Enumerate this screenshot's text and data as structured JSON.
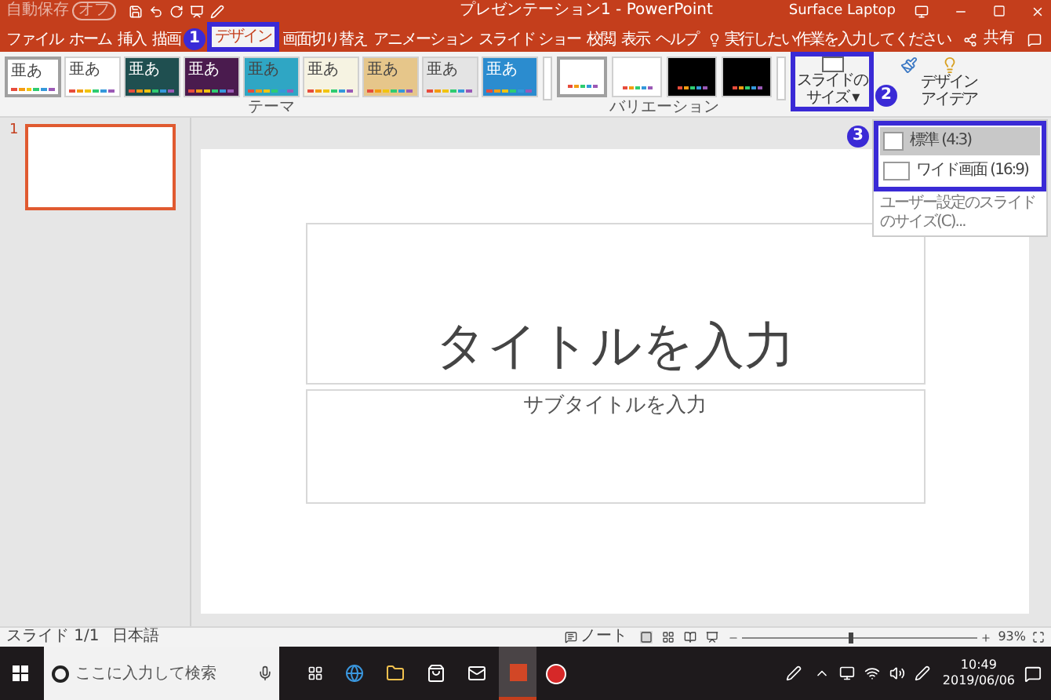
{
  "title_bar": {
    "autosave": {
      "label": "自動保存",
      "state": "オフ",
      "on": false
    },
    "title": "プレゼンテーション1 - PowerPoint",
    "account": "Surface Laptop"
  },
  "ribbon_tabs": [
    {
      "label": "ファイル",
      "selected": false
    },
    {
      "label": "ホーム",
      "selected": false
    },
    {
      "label": "挿入",
      "selected": false
    },
    {
      "label": "描画",
      "selected": false
    },
    {
      "label": "デザイン",
      "selected": true
    },
    {
      "label": "画面切り替え",
      "selected": false
    },
    {
      "label": "アニメーション",
      "selected": false
    },
    {
      "label": "スライド ショー",
      "selected": false
    },
    {
      "label": "校閲",
      "selected": false
    },
    {
      "label": "表示",
      "selected": false
    },
    {
      "label": "ヘルプ",
      "selected": false
    }
  ],
  "tell_me": {
    "placeholder": "実行したい作業を入力してください"
  },
  "share": "共有",
  "themes": {
    "label": "テーマ",
    "items": [
      {
        "sample": "亜あ",
        "color": "#ffffff",
        "dark": false,
        "selected": true
      },
      {
        "sample": "亜あ",
        "color": "#ffffff",
        "dark": false,
        "selected": false
      },
      {
        "sample": "亜あ",
        "color": "#1f4f50",
        "dark": true,
        "selected": false
      },
      {
        "sample": "亜あ",
        "color": "#4a1b4e",
        "dark": true,
        "selected": false
      },
      {
        "sample": "亜あ",
        "color": "#2fa6c4",
        "dark": false,
        "selected": false
      },
      {
        "sample": "亜あ",
        "color": "#f6f3e2",
        "dark": false,
        "selected": false
      },
      {
        "sample": "亜あ",
        "color": "#e6c68a",
        "dark": false,
        "selected": false
      },
      {
        "sample": "亜あ",
        "color": "#e4e4e4",
        "dark": false,
        "selected": false
      },
      {
        "sample": "亜あ",
        "color": "#2b8ccf",
        "dark": true,
        "selected": false
      }
    ]
  },
  "variations": {
    "label": "バリエーション",
    "items": [
      {
        "color": "#ffffff",
        "selected": true
      },
      {
        "color": "#ffffff",
        "selected": false
      },
      {
        "color": "#000000",
        "selected": false
      },
      {
        "color": "#000000",
        "selected": false
      }
    ]
  },
  "size_button": {
    "lines": [
      "スライドの",
      "サイズ ▾"
    ]
  },
  "design_ideas": {
    "lines": [
      "デザイン",
      "アイデア"
    ]
  },
  "slide_size_menu": {
    "items": [
      {
        "label": "標準 (4:3)",
        "kind": "standard",
        "selected": true
      },
      {
        "label": "ワイド画面 (16:9)",
        "kind": "wide",
        "selected": false
      }
    ],
    "custom": "ユーザー設定のスライドのサイズ(C)..."
  },
  "annotations": [
    {
      "number": "1"
    },
    {
      "number": "2"
    },
    {
      "number": "3"
    }
  ],
  "slides_pane": [
    {
      "number": "1",
      "selected": true
    }
  ],
  "slide": {
    "title_placeholder": "タイトルを入力",
    "subtitle_placeholder": "サブタイトルを入力"
  },
  "status_bar": {
    "slide_counter": "スライド 1/1",
    "language": "日本語",
    "notes": "ノート",
    "zoom": {
      "level": 0.45,
      "reading": "93%"
    }
  },
  "taskbar": {
    "search_placeholder": "ここに入力して検索",
    "time": "10:49",
    "date": "2019/06/06"
  }
}
